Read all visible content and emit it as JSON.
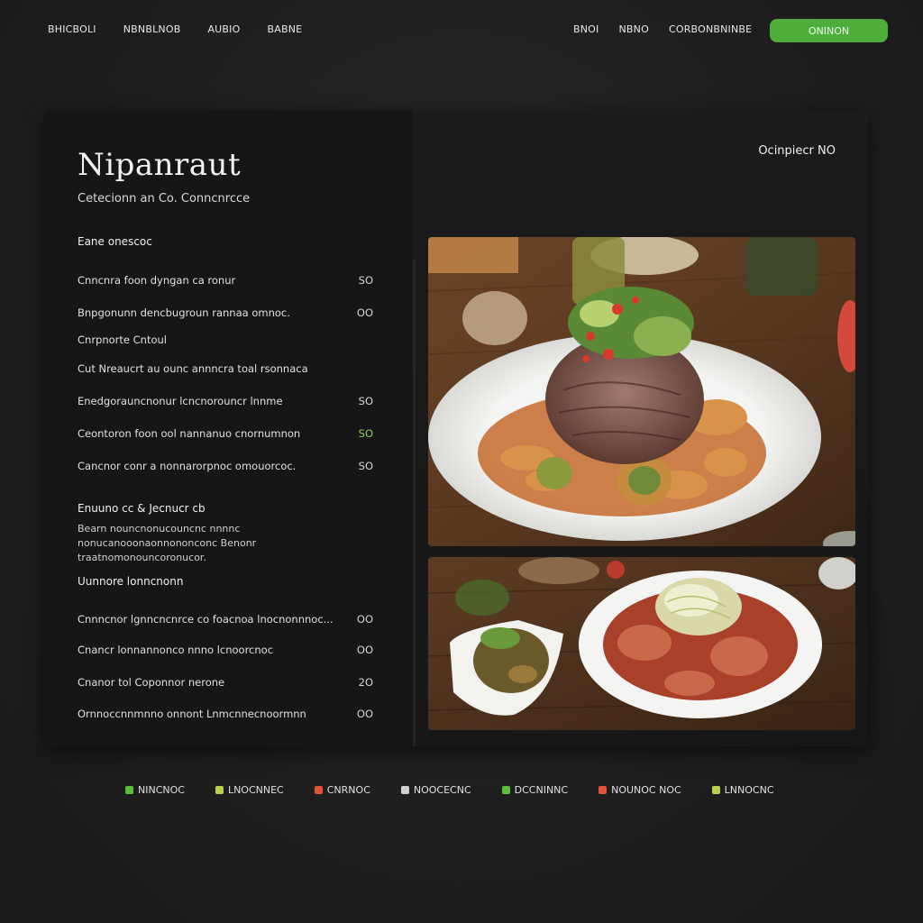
{
  "nav": {
    "left": [
      "BHICBOLI",
      "NBNBLNOB",
      "AUBIO",
      "BABNE"
    ],
    "right": [
      "BNOI",
      "NBNO",
      "CORBONBNINBE"
    ],
    "cta": "ONINON"
  },
  "card": {
    "title": "Nipanraut",
    "subtitle": "Cetecionn an Co. Conncnrcce",
    "badge": "Ocinpiecr NO",
    "section1": "Eane onescoc",
    "rows1": [
      {
        "name": "Cnncnra foon dyngan ca ronur",
        "price": "SO",
        "green": false
      },
      {
        "name": "Bnpgonunn dencbugroun rannaa omnoc.",
        "price": "OO",
        "green": false
      },
      {
        "name": "Cnrpnorte Cntoul",
        "price": "",
        "green": false
      },
      {
        "name": "Cut Nreaucrt au ounc annncra toal rsonnaca",
        "price": "",
        "green": false
      },
      {
        "name": "Enedgorauncnonur lcncnorouncr lnnme",
        "price": "SO",
        "green": false
      },
      {
        "name": "Ceontoron foon ool nannanuo cnornumnon",
        "price": "SO",
        "green": false
      },
      {
        "name": "Cancnor conr a nonnarorpnoc omouorcoc.",
        "price": "SO",
        "green": false
      }
    ],
    "section2": "Enuuno cc & Jecnucr cb",
    "desc2": "Bearn nouncnonucouncnc nnnnc nonucanooonaonnononconc Benonr traatnomonouncoronucor.",
    "section3": "Uunnore lonncnonn",
    "rows3": [
      {
        "name": "Cnnncnor lgnncncnrce co foacnoa lnocnonnnoc...",
        "price": "OO"
      },
      {
        "name": "Cnancr lonnannonco nnno lcnoorcnoc",
        "price": "OO"
      },
      {
        "name": "Cnanor tol Coponnor nerone",
        "price": "2O"
      },
      {
        "name": "Ornnoccnnmnno onnont Lnmcnnecnoormnn",
        "price": "OO"
      }
    ]
  },
  "footer": [
    {
      "label": "NINCNOC",
      "color": "#5dbb3a"
    },
    {
      "label": "LNOCNNEC",
      "color": "#b9d14a"
    },
    {
      "label": "CNRNOC",
      "color": "#e0553a"
    },
    {
      "label": "NOOCECNC",
      "color": "#d0d0d0"
    },
    {
      "label": "DCCNINNC",
      "color": "#5dbb3a"
    },
    {
      "label": "NOUNOC NOC",
      "color": "#e0553a"
    },
    {
      "label": "LNNOCNC",
      "color": "#b9d14a"
    }
  ]
}
